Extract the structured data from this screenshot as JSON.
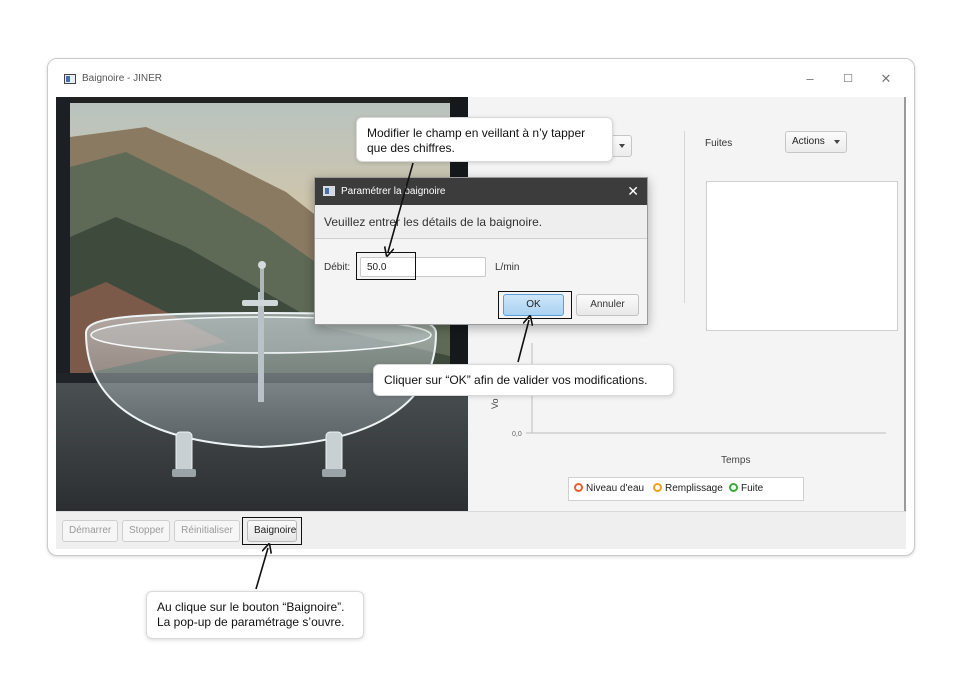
{
  "window": {
    "title": "Baignoire - JINER",
    "minimize": "–",
    "maximize": "☐",
    "close": "✕"
  },
  "right_panel": {
    "fuites_label": "Fuites",
    "actions_label": "Actions"
  },
  "chart_data": {
    "type": "line",
    "title": "",
    "xlabel": "Temps",
    "ylabel": "Vo",
    "y_ticks": [
      "0,0"
    ],
    "series": [
      {
        "name": "Niveau d'eau",
        "color": "#e8612c",
        "values": []
      },
      {
        "name": "Remplissage",
        "color": "#f0a01e",
        "values": []
      },
      {
        "name": "Fuite",
        "color": "#3caa3c",
        "values": []
      }
    ]
  },
  "bottom_buttons": {
    "demarrer": "Démarrer",
    "stopper": "Stopper",
    "reinitialiser": "Réinitialiser",
    "baignoire": "Baignoire"
  },
  "dialog": {
    "title": "Paramétrer la baignoire",
    "header": "Veuillez entrer les détails de la baignoire.",
    "debit_label": "Débit:",
    "debit_value": "50.0",
    "unit": "L/min",
    "ok_label": "OK",
    "cancel_label": "Annuler",
    "close": "✕"
  },
  "callouts": {
    "field": "Modifier le champ en veillant à n’y tapper que des chiffres.",
    "ok": "Cliquer sur “OK” afin de valider vos modifications.",
    "baignoire_line1": "Au clique sur le bouton “Baignoire”.",
    "baignoire_line2": "La pop-up de paramétrage s’ouvre."
  },
  "colors": {
    "dialog_titlebar": "#3c3c3c",
    "ok_button": "#a9d2f2",
    "niveau": "#e8612c",
    "remplissage": "#f0a01e",
    "fuite": "#3caa3c"
  }
}
